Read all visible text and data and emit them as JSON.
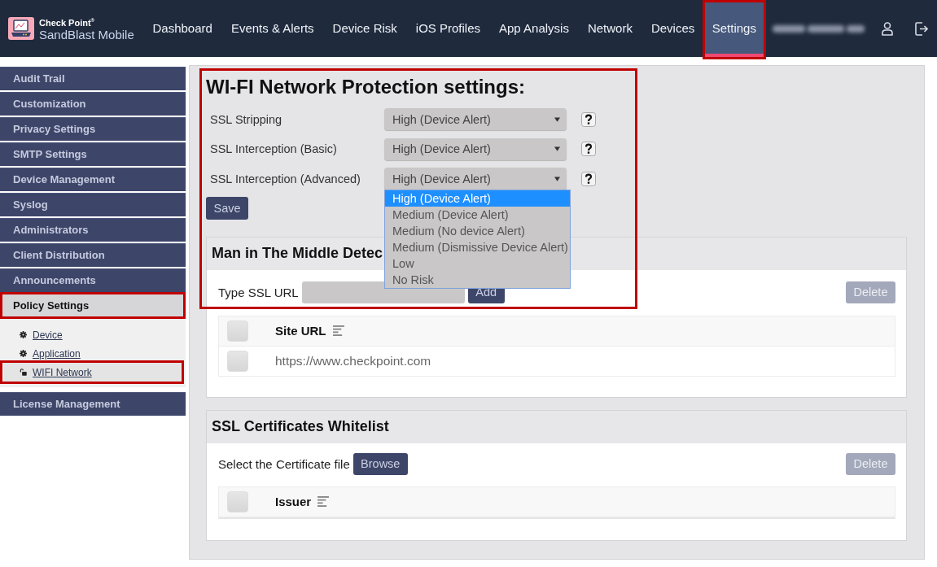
{
  "header": {
    "brand": {
      "company": "Check Point$^{®}$",
      "product": "SandBlast Mobile"
    },
    "nav": [
      {
        "label": "Dashboard",
        "selected": false,
        "annotated": false
      },
      {
        "label": "Events & Alerts",
        "selected": false,
        "annotated": false
      },
      {
        "label": "Device Risk",
        "selected": false,
        "annotated": false
      },
      {
        "label": "iOS Profiles",
        "selected": false,
        "annotated": false
      },
      {
        "label": "App Analysis",
        "selected": false,
        "annotated": false
      },
      {
        "label": "Network",
        "selected": false,
        "annotated": false
      },
      {
        "label": "Devices",
        "selected": false,
        "annotated": false
      },
      {
        "label": "Settings",
        "selected": true,
        "annotated": true
      }
    ]
  },
  "sidebar": {
    "items": [
      {
        "label": "Audit Trail",
        "selected": false,
        "annotated": false
      },
      {
        "label": "Customization",
        "selected": false,
        "annotated": false
      },
      {
        "label": "Privacy Settings",
        "selected": false,
        "annotated": false
      },
      {
        "label": "SMTP Settings",
        "selected": false,
        "annotated": false
      },
      {
        "label": "Device Management",
        "selected": false,
        "annotated": false
      },
      {
        "label": "Syslog",
        "selected": false,
        "annotated": false
      },
      {
        "label": "Administrators",
        "selected": false,
        "annotated": false
      },
      {
        "label": "Client Distribution",
        "selected": false,
        "annotated": false
      },
      {
        "label": "Announcements",
        "selected": false,
        "annotated": false
      },
      {
        "label": "Policy Settings",
        "selected": true,
        "annotated": true,
        "children": [
          {
            "label": "Device",
            "kind": "policy",
            "selected": false,
            "annotated": false
          },
          {
            "label": "Application",
            "kind": "policy",
            "selected": false,
            "annotated": false
          },
          {
            "label": "WIFI Network",
            "kind": "network",
            "selected": true,
            "annotated": true
          }
        ]
      },
      {
        "label": "License Management",
        "selected": false,
        "annotated": false
      }
    ]
  },
  "wifi_settings": {
    "title": "WI-FI Network Protection settings:",
    "annotated": true,
    "rows": [
      {
        "label": "SSL Stripping",
        "value": "High (Device Alert)"
      },
      {
        "label": "SSL Interception (Basic)",
        "value": "High (Device Alert)"
      },
      {
        "label": "SSL Interception (Advanced)",
        "value": "High (Device Alert)",
        "options": [
          {
            "label": "High (Device Alert)",
            "selected": true
          },
          {
            "label": "Medium (Device Alert)",
            "selected": false
          },
          {
            "label": "Medium (No device Alert)",
            "selected": false
          },
          {
            "label": "Medium (Dismissive Device Alert)",
            "selected": false
          },
          {
            "label": "Low",
            "selected": false
          },
          {
            "label": "No Risk",
            "selected": false
          }
        ]
      }
    ],
    "save_button": "Save"
  },
  "sections": [
    {
      "kind": "url",
      "title": "Man in The Middle Detec",
      "field_label": "Type SSL URL",
      "action_button": "Add",
      "delete_button": {
        "label": "Delete",
        "disabled": true
      },
      "table": {
        "columns": [
          "Site URL"
        ],
        "header_checked": false,
        "rows": [
          {
            "value": "https://www.checkpoint.com",
            "checked": false
          }
        ]
      }
    },
    {
      "kind": "file",
      "title": "SSL Certificates Whitelist",
      "field_label": "Select the Certificate file",
      "action_button": "Browse",
      "delete_button": {
        "label": "Delete",
        "disabled": true
      },
      "table": {
        "columns": [
          "Issuer"
        ],
        "header_checked": false
      }
    }
  ]
}
